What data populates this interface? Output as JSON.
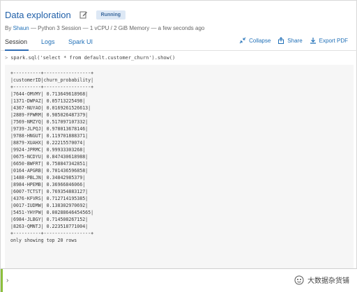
{
  "header": {
    "title": "Data exploration",
    "status": "Running",
    "meta_prefix": "By",
    "user": "Shaun",
    "meta_rest": " — Python 3 Session — 1 vCPU / 2 GiB Memory — a few seconds ago"
  },
  "tabs": [
    {
      "label": "Session"
    },
    {
      "label": "Logs"
    },
    {
      "label": "Spark UI"
    }
  ],
  "actions": {
    "collapse": "Collapse",
    "share": "Share",
    "export": "Export PDF"
  },
  "cell": {
    "prompt": ">",
    "code": "spark.sql('select * from default.customer_churn').show()",
    "output": "+----------+-----------------+\n|customerID|churn_probability|\n+----------+-----------------+\n|7644-OMVMY| 0.713649618968|\n|1371-DWPAZ| 0.05713225498|\n|4367-NUYAO| 0.0169261526613|\n|2889-FPWRM| 0.985026487379|\n|7569-NMZYQ| 0.517097107332|\n|9739-JLPQJ| 0.978013678146|\n|9788-HNGUT| 0.119701888371|\n|8879-XUAHX| 0.22215570074|\n|9924-JPRMC| 0.99933303268|\n|0675-NCDYU| 0.847430618988|\n|6650-BWFRT| 0.758847342851|\n|0164-APGRB| 0.701436596858|\n|1488-PBLJN| 0.34842985379|\n|8984-HPEMB| 0.36966846066|\n|6007-TCTST| 0.769354883127|\n|4376-KFVRS| 0.712714195385|\n|0017-IUDMW| 0.138302970692|\n|5451-YHYPW| 0.00288646454565|\n|6984-JLBGY| 0.714508267152|\n|8263-QMNTJ| 0.223518771004|\n+----------+-----------------+\nonly showing top 20 rows"
  },
  "input": {
    "chevron": "›"
  },
  "watermark": {
    "text": "大数据杂货铺"
  }
}
